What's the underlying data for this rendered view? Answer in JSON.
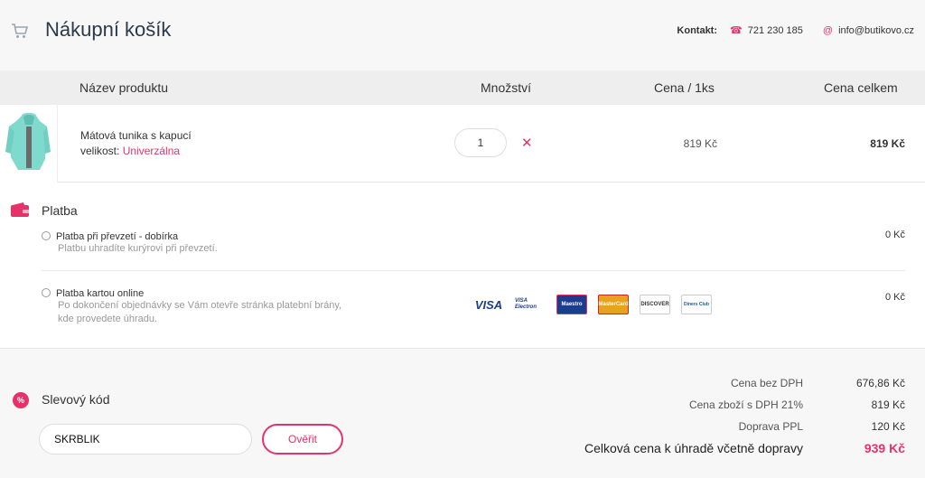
{
  "header": {
    "title": "Nákupní košík",
    "contact_label": "Kontakt:",
    "phone": "721 230 185",
    "email": "info@butikovo.cz"
  },
  "table": {
    "col_product": "Název produktu",
    "col_quantity": "Množství",
    "col_unit_price": "Cena / 1ks",
    "col_total": "Cena celkem"
  },
  "product": {
    "name": "Mátová tunika s kapucí",
    "size_label": "velikost:",
    "size_value": "Univerzálna",
    "quantity": "1",
    "unit_price": "819 Kč",
    "total_price": "819 Kč"
  },
  "payment": {
    "title": "Platba",
    "options": [
      {
        "title": "Platba při převzetí - dobírka",
        "desc": "Platbu uhradíte kurýrovi při převzetí.",
        "price": "0 Kč"
      },
      {
        "title": "Platba kartou online",
        "desc1": "Po dokončení objednávky se Vám otevře stránka platební brány,",
        "desc2": "kde provedete úhradu.",
        "price": "0 Kč"
      }
    ],
    "cards": [
      "VISA",
      "VISA Electron",
      "Maestro",
      "MasterCard",
      "DISCOVER",
      "Diners Club"
    ]
  },
  "coupon": {
    "title": "Slevový kód",
    "value": "SKRBLIK",
    "verify_label": "Ověřit"
  },
  "summary": {
    "rows": [
      {
        "label": "Cena bez DPH",
        "value": "676,86 Kč"
      },
      {
        "label": "Cena zboží s DPH 21%",
        "value": "819 Kč"
      },
      {
        "label": "Doprava PPL",
        "value": "120 Kč"
      }
    ],
    "total_label": "Celková cena k úhradě včetně dopravy",
    "total_value": "939 Kč"
  },
  "colors": {
    "accent": "#e5336a",
    "title": "#2b3a4a",
    "background": "#f7f7f7"
  }
}
